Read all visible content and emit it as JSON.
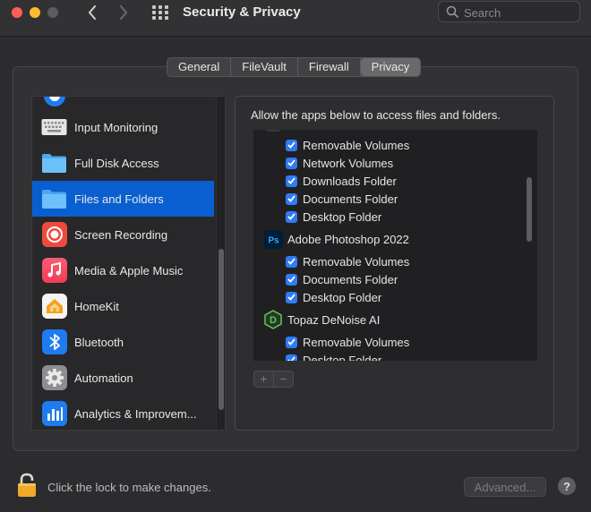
{
  "window": {
    "title": "Security & Privacy"
  },
  "search": {
    "placeholder": "Search"
  },
  "tabs": [
    {
      "label": "General"
    },
    {
      "label": "FileVault"
    },
    {
      "label": "Firewall"
    },
    {
      "label": "Privacy",
      "active": true
    }
  ],
  "sidebar": {
    "items": [
      {
        "label": "Input Monitoring",
        "icon": "keyboard-icon"
      },
      {
        "label": "Full Disk Access",
        "icon": "folder-icon"
      },
      {
        "label": "Files and Folders",
        "icon": "folder-icon",
        "selected": true
      },
      {
        "label": "Screen Recording",
        "icon": "screen-recording-icon"
      },
      {
        "label": "Media & Apple Music",
        "icon": "music-icon"
      },
      {
        "label": "HomeKit",
        "icon": "homekit-icon"
      },
      {
        "label": "Bluetooth",
        "icon": "bluetooth-icon"
      },
      {
        "label": "Automation",
        "icon": "gear-icon"
      },
      {
        "label": "Analytics & Improvem...",
        "icon": "analytics-icon"
      }
    ]
  },
  "content": {
    "description": "Allow the apps below to access files and folders.",
    "rows": [
      {
        "type": "perm",
        "label": "Removable Volumes",
        "checked": true
      },
      {
        "type": "perm",
        "label": "Network Volumes",
        "checked": true
      },
      {
        "type": "perm",
        "label": "Downloads Folder",
        "checked": true
      },
      {
        "type": "perm",
        "label": "Documents Folder",
        "checked": true
      },
      {
        "type": "perm",
        "label": "Desktop Folder",
        "checked": true
      },
      {
        "type": "app",
        "label": "Adobe Photoshop 2022",
        "icon": "photoshop-icon",
        "icon_text": "Ps"
      },
      {
        "type": "perm",
        "label": "Removable Volumes",
        "checked": true
      },
      {
        "type": "perm",
        "label": "Documents Folder",
        "checked": true
      },
      {
        "type": "perm",
        "label": "Desktop Folder",
        "checked": true
      },
      {
        "type": "app",
        "label": "Topaz DeNoise AI",
        "icon": "topaz-icon",
        "icon_text": "D"
      },
      {
        "type": "perm",
        "label": "Removable Volumes",
        "checked": true
      },
      {
        "type": "perm",
        "label": "Desktop Folder",
        "checked": true
      }
    ],
    "add_label": "+",
    "remove_label": "−"
  },
  "footer": {
    "lock_text": "Click the lock to make changes.",
    "advanced_label": "Advanced...",
    "help_label": "?"
  },
  "colors": {
    "accent": "#0a5fd0",
    "checkbox": "#2f7bf5",
    "background": "#2c2c2e"
  }
}
